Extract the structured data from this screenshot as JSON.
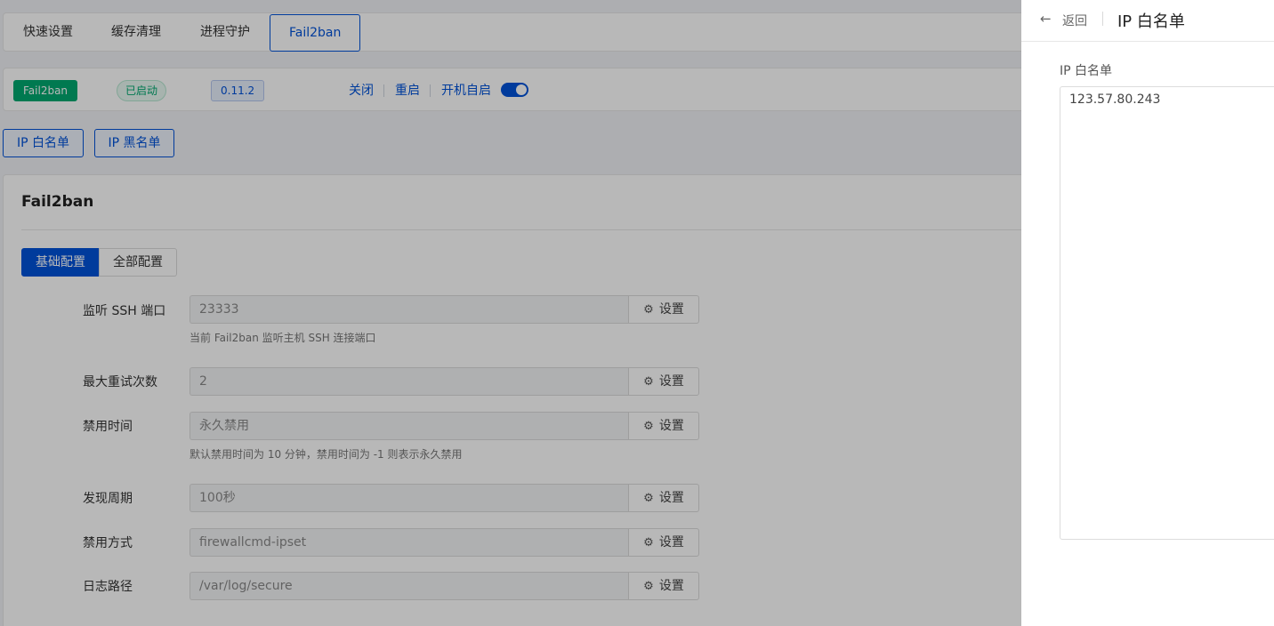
{
  "tabs": [
    "快速设置",
    "缓存清理",
    "进程守护",
    "Fail2ban"
  ],
  "status": {
    "service_tag": "Fail2ban",
    "state_tag": "已启动",
    "version": "0.11.2",
    "actions": [
      "关闭",
      "重启",
      "开机自启"
    ],
    "autostart_on": true
  },
  "ip_buttons": [
    "IP 白名单",
    "IP 黑名单"
  ],
  "card": {
    "title": "Fail2ban",
    "segments": [
      "基础配置",
      "全部配置"
    ],
    "set_label": "设置",
    "rows": [
      {
        "label": "监听 SSH 端口",
        "value": "23333",
        "help": "当前 Fail2ban 监听主机 SSH 连接端口"
      },
      {
        "label": "最大重试次数",
        "value": "2",
        "help": ""
      },
      {
        "label": "禁用时间",
        "value": "永久禁用",
        "help": "默认禁用时间为 10 分钟，禁用时间为 -1 则表示永久禁用"
      },
      {
        "label": "发现周期",
        "value": "100秒",
        "help": ""
      },
      {
        "label": "禁用方式",
        "value": "firewallcmd-ipset",
        "help": ""
      },
      {
        "label": "日志路径",
        "value": "/var/log/secure",
        "help": ""
      }
    ]
  },
  "drawer": {
    "back_label": "返回",
    "title": "IP 白名单",
    "field_label": "IP 白名单",
    "whitelist_value": "123.57.80.243"
  },
  "colors": {
    "accent": "#0052d9",
    "success": "#00a870"
  }
}
